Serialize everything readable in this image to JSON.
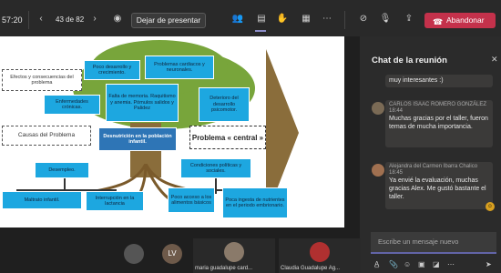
{
  "topbar": {
    "time": "57:20",
    "slide_indicator": "43 de 82",
    "stop_presenting": "Dejar de presentar",
    "leave": "Abandonar"
  },
  "slide": {
    "boxes": {
      "efectos": "Efectos y consecuencias del problema",
      "poco_desarrollo": "Poco desarrollo y crecimiento.",
      "cardiacos": "Problemas cardiacos y neuronales.",
      "enfermedades": "Enfermedades crónicas.",
      "memoria": "Falta de memoria. Raquitismo y anemia. Pómulos salidos y Palidez",
      "deterioro": "Deterioro del desarrollo psicomotor.",
      "causas": "Causas del Problema",
      "desnutricion": "Desnutrición en la población infantil.",
      "problema_central": "Problema « central »",
      "desempleo": "Desempleo.",
      "condiciones": "Condiciones políticas y sociales.",
      "maltrato": "Maltrato infantil.",
      "interrupcion": "Interrupción en la lactancia",
      "acceso": "Poco acceso a los alimentos básicos",
      "ingesta": "Poca ingesta de nutrientes en el periodo embrionario."
    }
  },
  "chat": {
    "title": "Chat de la reunión",
    "messages": [
      {
        "text": "muy interesantes :)"
      },
      {
        "author": "CARLOS ISAAC ROMERO GONZÁLEZ",
        "time": "18:44",
        "text": "Muchas gracias por el taller, fueron temas de mucha importancia."
      },
      {
        "author": "Alejandra del Carmen Ibarra Chalico",
        "time": "18:45",
        "text": "Ya envié la evaluación, muchas gracias Alex. Me gustó bastante el taller."
      }
    ],
    "input_placeholder": "Escribe un mensaje nuevo"
  },
  "participants": [
    {
      "initials": ""
    },
    {
      "initials": "LV"
    },
    {
      "name": "maria guadalupe card..."
    },
    {
      "name": "Claudia Guadalupe Ag..."
    }
  ],
  "colors": {
    "leave_red": "#c4314b",
    "accent": "#6264a7",
    "cyan_box": "#1da7e0",
    "tree_green": "#78a53b"
  }
}
